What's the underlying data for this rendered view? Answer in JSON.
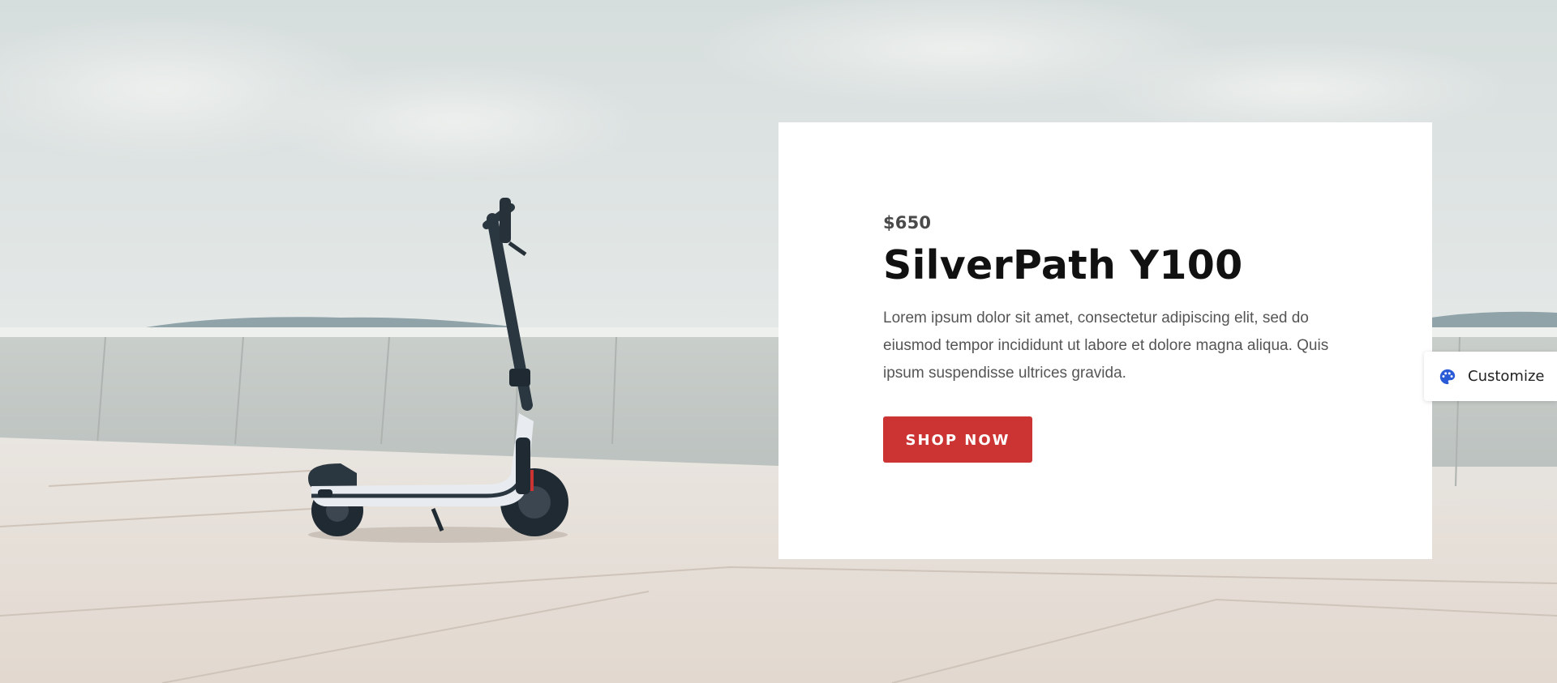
{
  "hero": {
    "price": "$650",
    "title": "SilverPath Y100",
    "description": "Lorem ipsum dolor sit amet, consectetur adipiscing elit, sed do eiusmod tempor incididunt ut labore et dolore magna aliqua. Quis ipsum suspendisse ultrices gravida.",
    "cta_label": "SHOP NOW",
    "background_image": "scooter-on-terrace-icon"
  },
  "customize_panel": {
    "label": "Customize",
    "icon": "palette-icon"
  },
  "colors": {
    "accent": "#cc3333",
    "card_background": "#ffffff",
    "palette_icon": "#2a5bd7"
  }
}
